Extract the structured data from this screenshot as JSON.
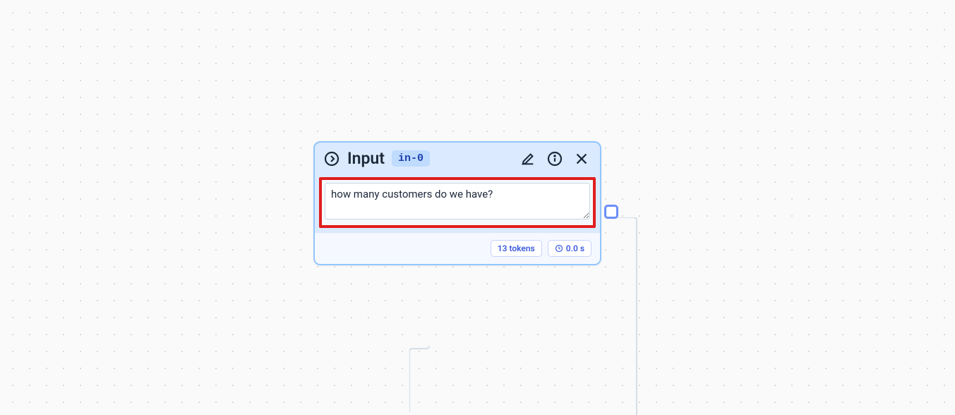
{
  "node": {
    "title": "Input",
    "id": "in-0",
    "textarea_value": "how many customers do we have?",
    "textarea_placeholder": ""
  },
  "stats": {
    "tokens": "13 tokens",
    "time": "0.0 s"
  },
  "icons": {
    "arrow_right_circle": "arrow-right-circle",
    "edit": "edit",
    "info": "info",
    "close": "close",
    "clock": "clock"
  }
}
